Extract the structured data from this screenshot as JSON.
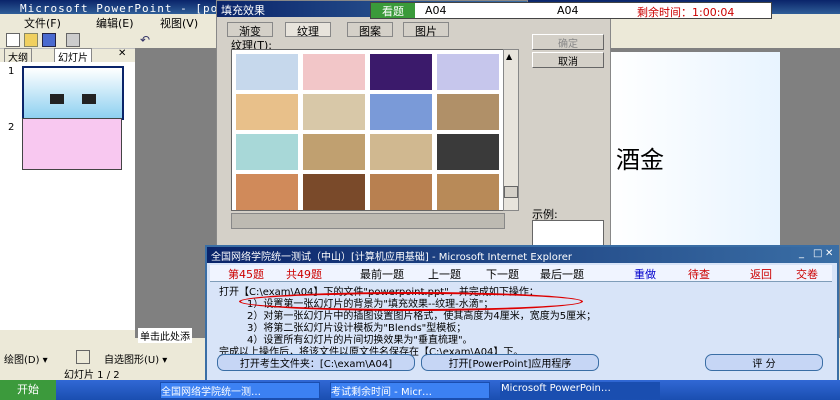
{
  "app": {
    "title": "Microsoft PowerPoint - [po"
  },
  "menu": [
    "文件(F)",
    "编辑(E)",
    "视图(V)"
  ],
  "left_tabs": [
    "大纲",
    "幻灯片"
  ],
  "slides": [
    "1",
    "2"
  ],
  "slide_text": "酒金",
  "click_hint": "单击此处添",
  "draw_toolbar": {
    "draw": "绘图(D) ▾",
    "autoshapes": "自选图形(U) ▾"
  },
  "status_text": "幻灯片 1 / 2",
  "dialog": {
    "title": "填充效果",
    "tabs": [
      "渐变",
      "纹理",
      "图案",
      "图片"
    ],
    "texture_label": "纹理(T):",
    "ok": "确定",
    "cancel": "取消",
    "example_label": "示例:"
  },
  "textures": [
    [
      "#c6d8ec",
      "#f2c6c8",
      "#3b1a6b",
      "#c6c6ec"
    ],
    [
      "#e8c08a",
      "#d8c8a8",
      "#7a9ad8",
      "#b09068"
    ],
    [
      "#a8d8d8",
      "#c0a070",
      "#d0b890",
      "#3a3a3a"
    ],
    [
      "#d08a5a",
      "#7a4a2a",
      "#b88050",
      "#b88a58"
    ]
  ],
  "exam_status": {
    "view": "看题",
    "code1": "A04",
    "code2": "A04",
    "timer": "剩余时间：1:00:04"
  },
  "exam": {
    "title": "全国网络学院统一测试（中山）[计算机应用基础] - Microsoft Internet Explorer",
    "nav": {
      "qnum": "第45题",
      "total": "共49题",
      "first": "最前一题",
      "prev": "上一题",
      "next": "下一题",
      "last": "最后一题",
      "redo": "重做",
      "review": "待查",
      "back": "返回",
      "submit": "交卷"
    },
    "lines": [
      "打开【C:\\exam\\A04】下的文件\"powerpoint.ppt\"，并完成如下操作：",
      "1）设置第一张幻灯片的背景为\"填充效果--纹理-水滴\"；",
      "2）对第一张幻灯片中的插图设置图片格式，使其高度为4厘米，宽度为5厘米；",
      "3）将第二张幻灯片设计模板为\"Blends\"型模板；",
      "4）设置所有幻灯片的片间切换效果为\"垂直梳理\"。",
      "完成以上操作后，将该文件以原文件名保存在【C:\\exam\\A04】下。"
    ],
    "btn_open_folder": "打开考生文件夹：[C:\\exam\\A04]",
    "btn_open_app": "打开[PowerPoint]应用程序",
    "btn_score": "评  分"
  },
  "taskbar": {
    "start": "开始",
    "items": [
      "全国网络学院统一测…",
      "考试剩余时间 - Micr…",
      "Microsoft PowerPoin…"
    ]
  }
}
